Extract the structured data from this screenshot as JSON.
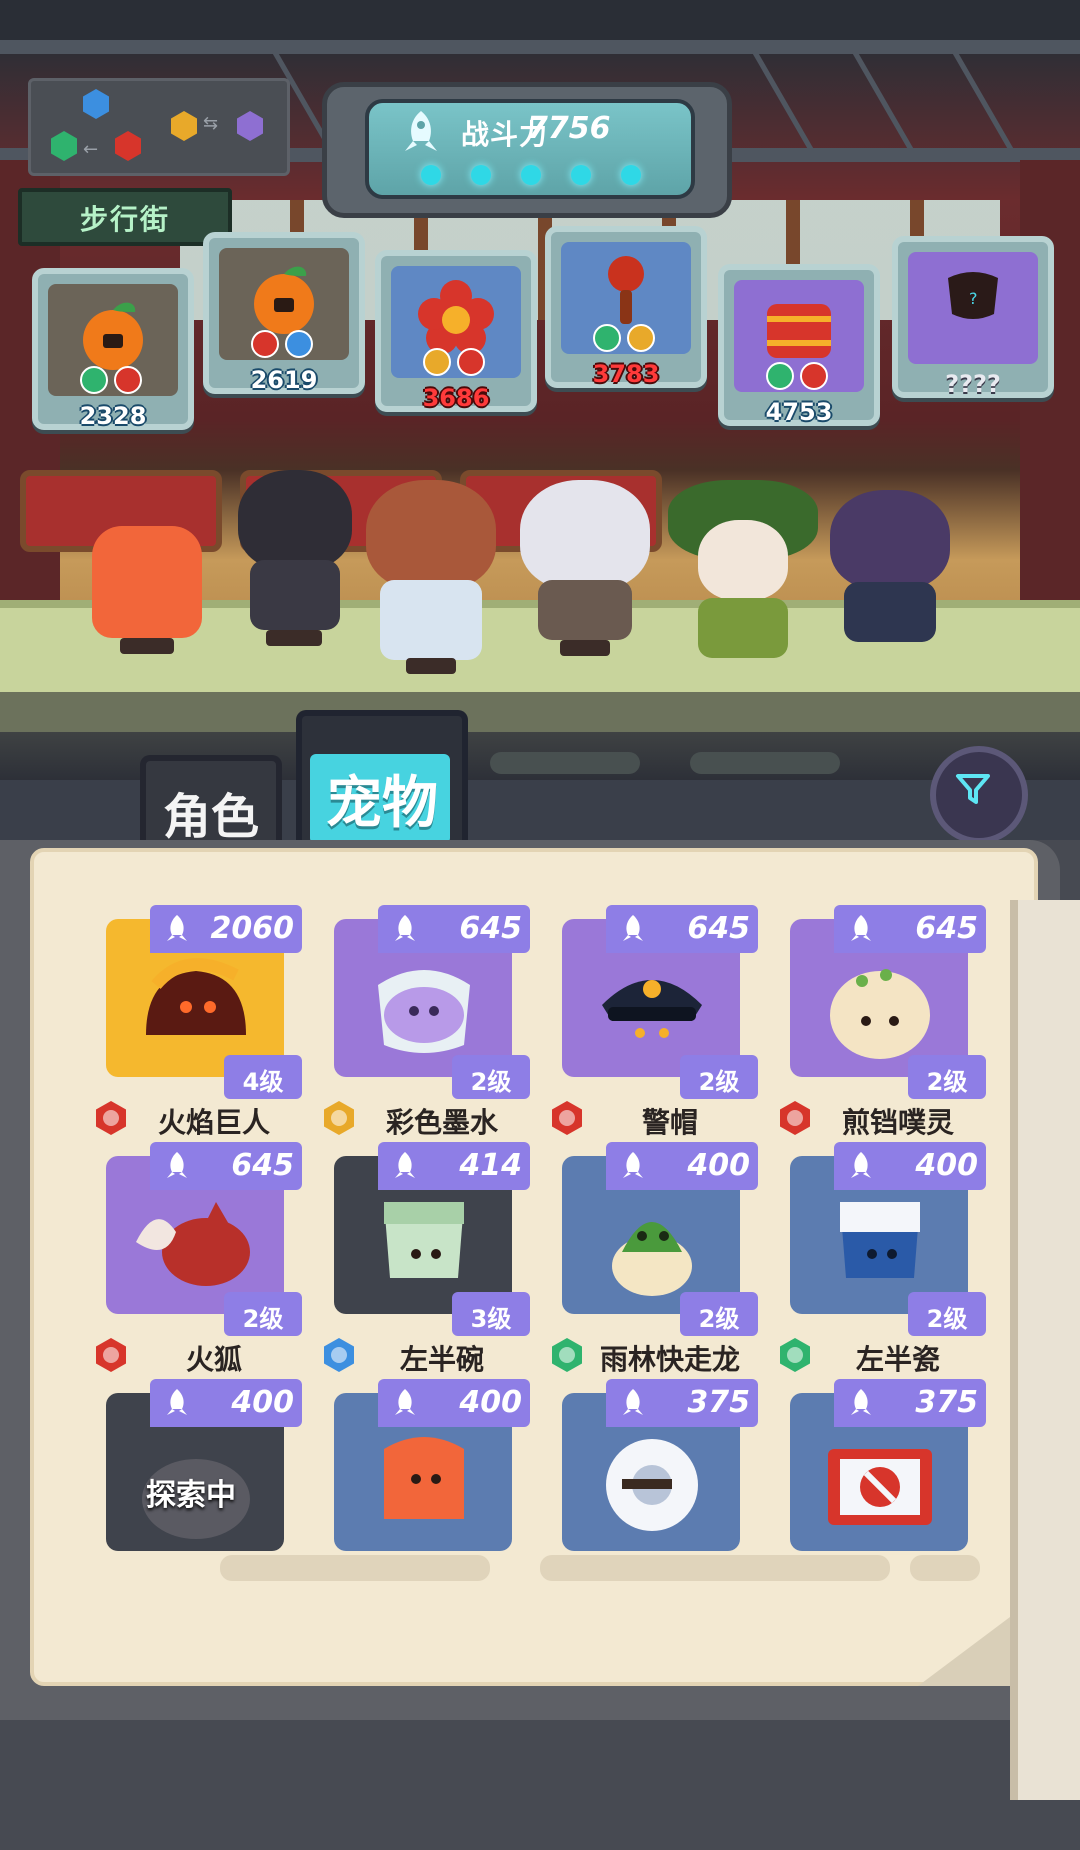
{
  "header": {
    "location_label": "步行街",
    "power_label": "战斗力",
    "power_value": "7756",
    "power_dots": 5
  },
  "team_cards": [
    {
      "value": "2328",
      "color": "blue",
      "elements": [
        "nature",
        "fire"
      ]
    },
    {
      "value": "2619",
      "color": "blue",
      "elements": [
        "fire",
        "water"
      ]
    },
    {
      "value": "3686",
      "color": "red",
      "elements": [
        "light",
        "fire"
      ]
    },
    {
      "value": "3783",
      "color": "red",
      "elements": [
        "nature",
        "light"
      ]
    },
    {
      "value": "4753",
      "color": "blue",
      "elements": [
        "nature",
        "fire"
      ]
    },
    {
      "value": "????",
      "color": "unknown",
      "elements": []
    }
  ],
  "tabs": {
    "character": "角色",
    "pet": "宠物",
    "active": "pet"
  },
  "pets": [
    {
      "name": "火焰巨人",
      "power": "2060",
      "level": "4级",
      "element": "fire",
      "rarity": "gold"
    },
    {
      "name": "彩色墨水",
      "power": "645",
      "level": "2级",
      "element": "light",
      "rarity": "purple"
    },
    {
      "name": "警帽",
      "power": "645",
      "level": "2级",
      "element": "fire",
      "rarity": "purple"
    },
    {
      "name": "煎铛噗灵",
      "power": "645",
      "level": "2级",
      "element": "fire",
      "rarity": "purple"
    },
    {
      "name": "火狐",
      "power": "645",
      "level": "2级",
      "element": "fire",
      "rarity": "purple"
    },
    {
      "name": "左半碗",
      "power": "414",
      "level": "3级",
      "element": "water",
      "rarity": "dark"
    },
    {
      "name": "雨林快走龙",
      "power": "400",
      "level": "2级",
      "element": "nature",
      "rarity": "steel"
    },
    {
      "name": "左半瓷",
      "power": "400",
      "level": "2级",
      "element": "nature",
      "rarity": "steel"
    },
    {
      "name": "",
      "power": "400",
      "level": "",
      "element": "",
      "rarity": "dark",
      "status": "探索中"
    },
    {
      "name": "",
      "power": "400",
      "level": "",
      "element": "",
      "rarity": "steel"
    },
    {
      "name": "",
      "power": "375",
      "level": "",
      "element": "",
      "rarity": "steel"
    },
    {
      "name": "",
      "power": "375",
      "level": "",
      "element": "",
      "rarity": "steel"
    }
  ],
  "colors": {
    "fire": "#d7352b",
    "water": "#3c8fe0",
    "nature": "#2fb36e",
    "light": "#e8a92a",
    "accent": "#8e7ee6",
    "tab_active": "#47d3e0"
  }
}
